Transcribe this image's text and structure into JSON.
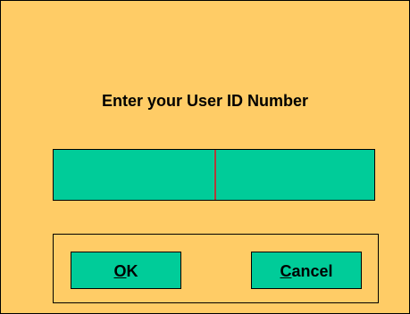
{
  "dialog": {
    "prompt": "Enter your User ID Number",
    "id_field": {
      "value": ""
    },
    "buttons": {
      "ok": {
        "mnemonic": "O",
        "rest": "K"
      },
      "cancel": {
        "mnemonic": "C",
        "rest": "ancel"
      }
    }
  },
  "colors": {
    "background": "#ffcc66",
    "field": "#00cc99",
    "caret": "#b33a3a",
    "border": "#000000"
  }
}
